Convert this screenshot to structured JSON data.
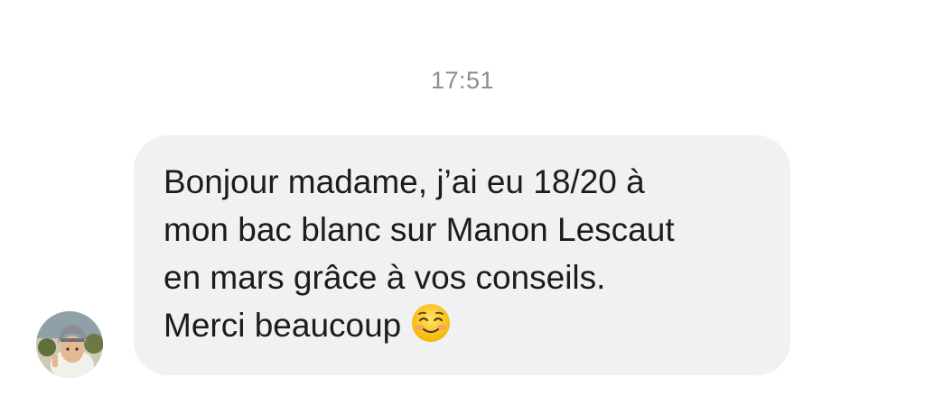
{
  "conversation": {
    "timestamp": "17:51",
    "message": {
      "lines": [
        "Bonjour madame, j’ai eu 18/20 à",
        "mon bac blanc sur Manon Lescaut",
        "en mars grâce à vos conseils.",
        "Merci beaucoup"
      ],
      "emoji": "smiling-face-with-blush-icon"
    }
  },
  "colors": {
    "bubble": "#f0f1f3",
    "text": "#1c1c1e",
    "timestamp": "#8e8e93"
  }
}
